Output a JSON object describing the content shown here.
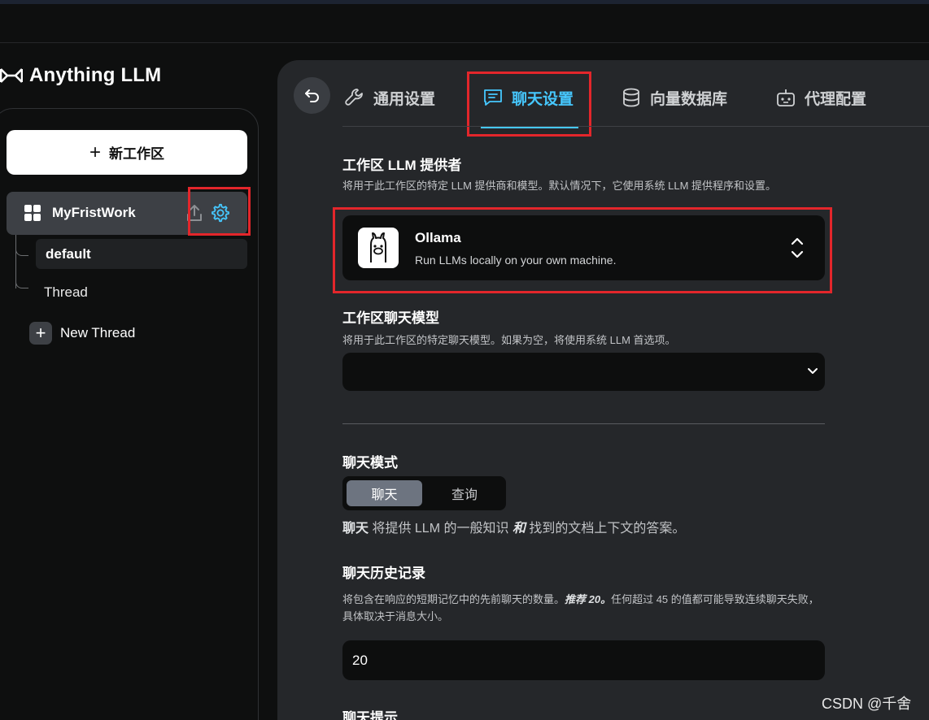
{
  "app": {
    "name": "Anything LLM"
  },
  "sidebar": {
    "new_workspace_label": "新工作区",
    "workspace": {
      "name": "MyFristWork"
    },
    "threads": [
      "default",
      "Thread"
    ],
    "new_thread_label": "New Thread"
  },
  "tabs": [
    {
      "label": "通用设置",
      "icon": "wrench-icon"
    },
    {
      "label": "聊天设置",
      "icon": "chat-icon",
      "active": true
    },
    {
      "label": "向量数据库",
      "icon": "database-icon"
    },
    {
      "label": "代理配置",
      "icon": "robot-icon"
    }
  ],
  "settings": {
    "provider": {
      "title": "工作区 LLM 提供者",
      "desc": "将用于此工作区的特定 LLM 提供商和模型。默认情况下，它使用系统 LLM 提供程序和设置。",
      "name": "Ollama",
      "tagline": "Run LLMs locally on your own machine."
    },
    "model": {
      "title": "工作区聊天模型",
      "desc": "将用于此工作区的特定聊天模型。如果为空，将使用系统 LLM 首选项。",
      "value": ""
    },
    "mode": {
      "title": "聊天模式",
      "options": [
        "聊天",
        "查询"
      ],
      "selected": "聊天",
      "desc_bold": "聊天",
      "desc_part1": " 将提供 LLM 的一般知识 ",
      "desc_italic": "和",
      "desc_part2": " 找到的文档上下文的答案。"
    },
    "history": {
      "title": "聊天历史记录",
      "desc_part1": "将包含在响应的短期记忆中的先前聊天的数量。",
      "desc_italic": "推荐 20。",
      "desc_part2": "任何超过 45 的值都可能导致连续聊天失败，具体取决于消息大小。",
      "value": "20"
    },
    "prompt": {
      "title": "聊天提示"
    }
  },
  "watermark": "CSDN @千舍",
  "colors": {
    "accent": "#46c8ff",
    "highlight_box": "#e3262b",
    "panel": "#25272a",
    "sidebar_bg": "#0e0f0f"
  }
}
